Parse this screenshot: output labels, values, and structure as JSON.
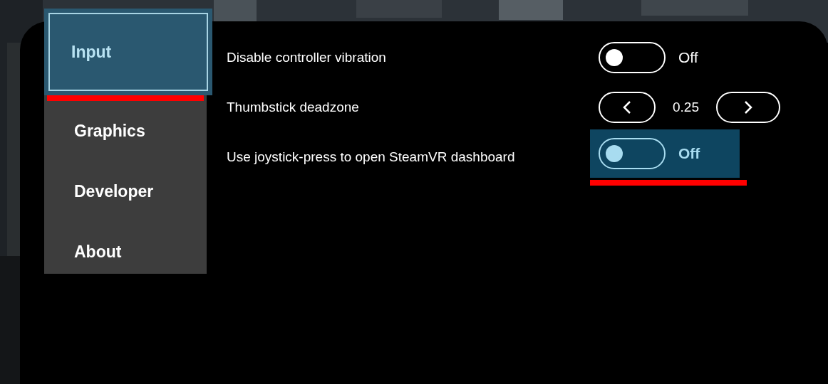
{
  "sidebar": {
    "items": [
      {
        "label": "Input",
        "selected": true
      },
      {
        "label": "Graphics",
        "selected": false
      },
      {
        "label": "Developer",
        "selected": false
      },
      {
        "label": "About",
        "selected": false
      }
    ]
  },
  "settings": [
    {
      "kind": "toggle",
      "label": "Disable controller vibration",
      "on": false,
      "value": "Off",
      "focused": false
    },
    {
      "kind": "stepper",
      "label": "Thumbstick deadzone",
      "value": "0.25",
      "focused": false
    },
    {
      "kind": "toggle",
      "label": "Use joystick-press to open SteamVR dashboard",
      "on": false,
      "value": "Off",
      "focused": true
    }
  ]
}
